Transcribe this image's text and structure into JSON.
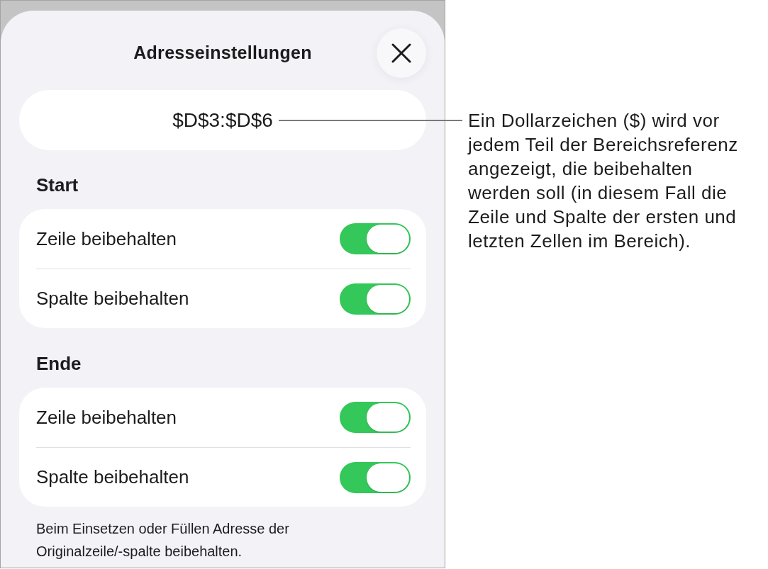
{
  "sheet": {
    "title": "Adresseinstellungen",
    "address_field": {
      "value": "$D$3:$D$6"
    },
    "sections": [
      {
        "heading": "Start",
        "rows": [
          {
            "label": "Zeile beibehalten",
            "on": true
          },
          {
            "label": "Spalte beibehalten",
            "on": true
          }
        ]
      },
      {
        "heading": "Ende",
        "rows": [
          {
            "label": "Zeile beibehalten",
            "on": true
          },
          {
            "label": "Spalte beibehalten",
            "on": true
          }
        ]
      }
    ],
    "footnote": "Beim Einsetzen oder Füllen Adresse der Originalzeile/-spalte beibehalten."
  },
  "callout": {
    "text": "Ein Dollarzeichen ($) wird vor jedem Teil der Bereichsreferenz angezeigt, die beibehalten werden soll (in diesem Fall die Zeile und Spalte der ersten und letzten Zellen im Bereich)."
  }
}
